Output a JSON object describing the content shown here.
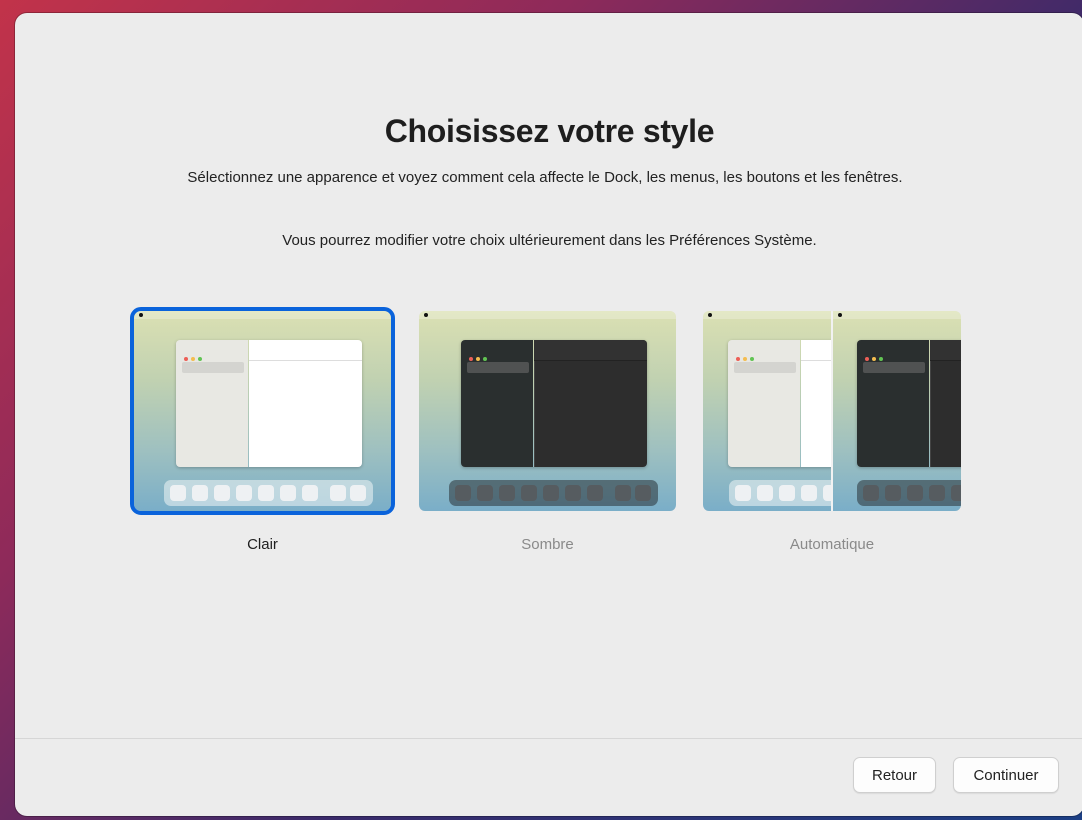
{
  "setup": {
    "title": "Choisissez votre style",
    "description": "Sélectionnez une apparence et voyez comment cela affecte le Dock, les menus, les boutons et les fenêtres.",
    "note": "Vous pourrez modifier votre choix ultérieurement dans les Préférences Système."
  },
  "options": [
    {
      "label": "Clair",
      "selected": true
    },
    {
      "label": "Sombre",
      "selected": false
    },
    {
      "label": "Automatique",
      "selected": false
    }
  ],
  "buttons": {
    "back": "Retour",
    "continue": "Continuer"
  },
  "colors": {
    "accent": "#0a63db",
    "window": "#ececec"
  }
}
